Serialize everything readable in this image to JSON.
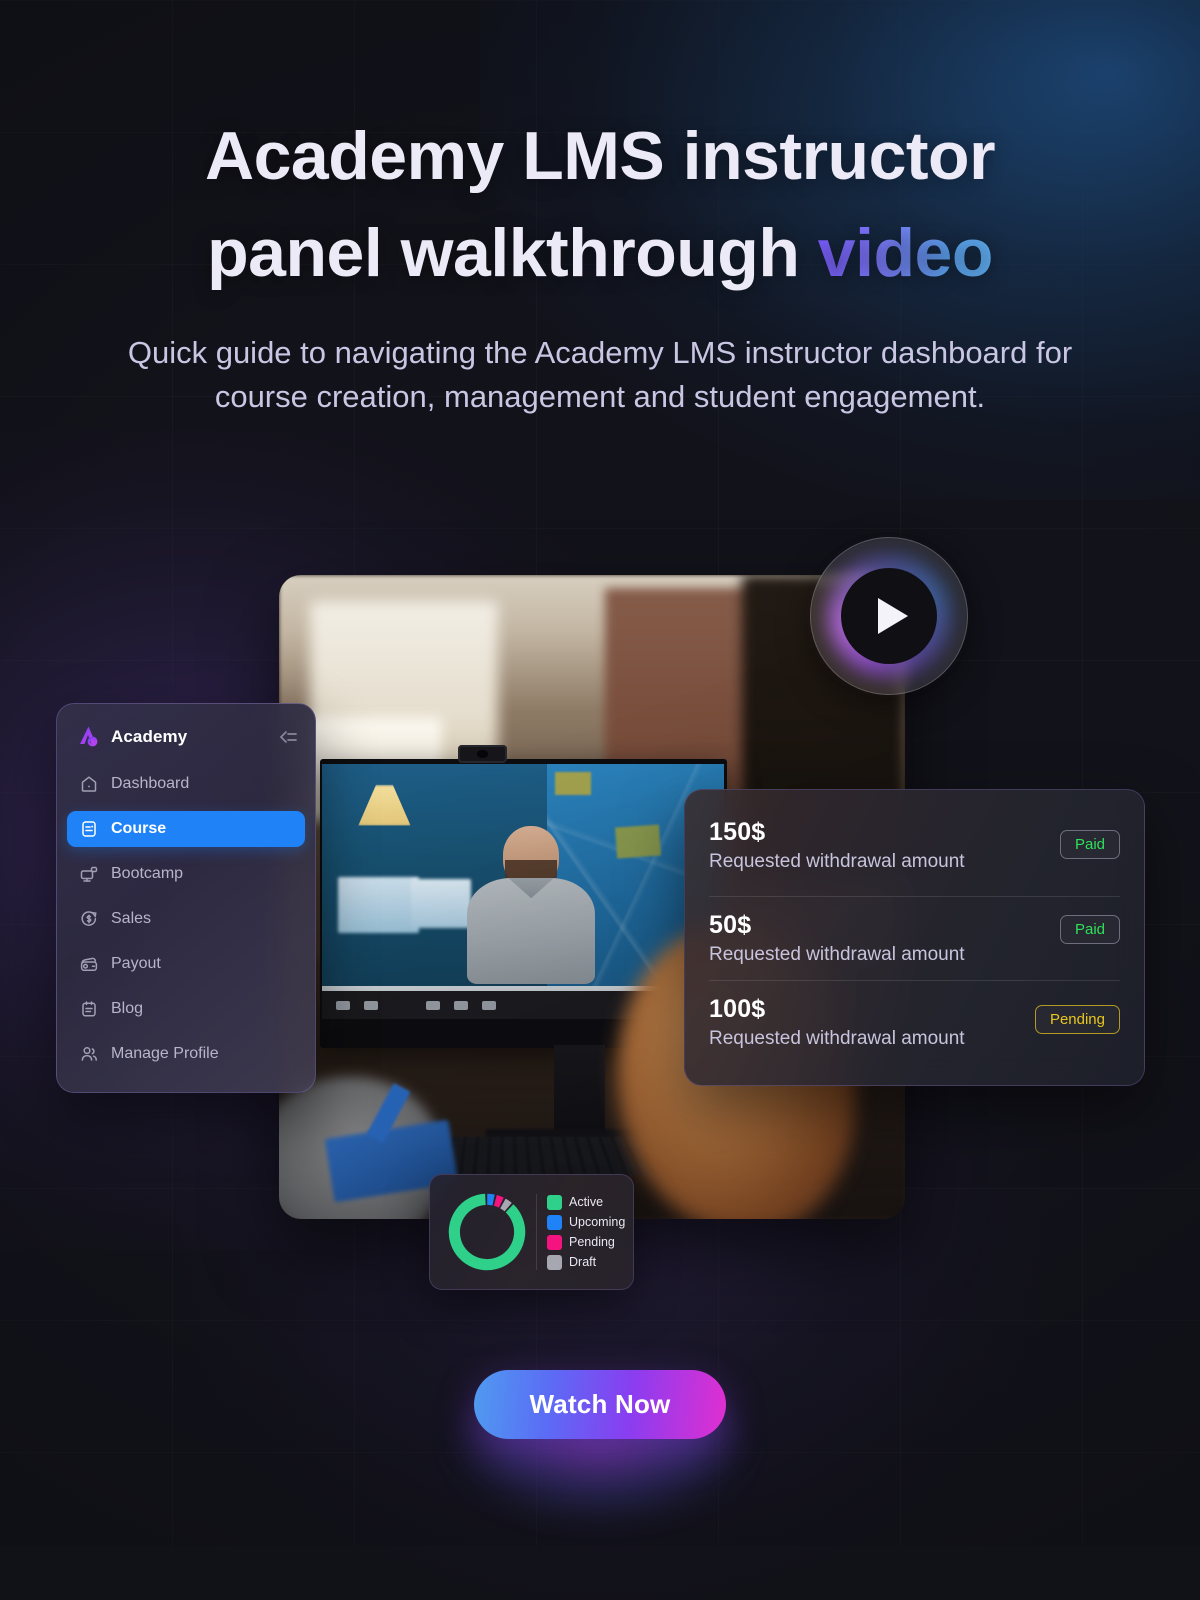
{
  "hero": {
    "title_line1": "Academy LMS instructor",
    "title_line2_prefix": "panel walkthrough ",
    "title_accent": "video",
    "subtitle": "Quick guide to navigating the Academy LMS instructor dashboard for course creation, management and student engagement."
  },
  "sidebar": {
    "brand": "Academy",
    "collapse_icon": "collapse-sidebar-icon",
    "logo_icon": "academy-logo-icon",
    "items": [
      {
        "label": "Dashboard",
        "icon": "home-icon",
        "active": false
      },
      {
        "label": "Course",
        "icon": "document-icon",
        "active": true
      },
      {
        "label": "Bootcamp",
        "icon": "monitor-icon",
        "active": false
      },
      {
        "label": "Sales",
        "icon": "dollar-circle-icon",
        "active": false
      },
      {
        "label": "Payout",
        "icon": "wallet-icon",
        "active": false
      },
      {
        "label": "Blog",
        "icon": "clipboard-icon",
        "active": false
      },
      {
        "label": "Manage Profile",
        "icon": "users-icon",
        "active": false
      }
    ]
  },
  "withdrawals": {
    "rows": [
      {
        "amount": "150$",
        "description": "Requested withdrawal amount",
        "status": "Paid",
        "status_type": "paid"
      },
      {
        "amount": "50$",
        "description": "Requested withdrawal amount",
        "status": "Paid",
        "status_type": "paid"
      },
      {
        "amount": "100$",
        "description": "Requested withdrawal amount",
        "status": "Pending",
        "status_type": "pending"
      }
    ]
  },
  "video": {
    "play_icon": "play-icon",
    "thumbnail_alt": "video-conference-thumbnail"
  },
  "cta": {
    "label": "Watch Now"
  },
  "chart_data": {
    "type": "pie",
    "title": "",
    "legend_position": "right",
    "categories": [
      "Active",
      "Upcoming",
      "Pending",
      "Draft"
    ],
    "values": [
      88,
      4,
      4,
      4
    ],
    "colors": [
      "#2fd18a",
      "#1f83f7",
      "#f5147f",
      "#a7a7b2"
    ]
  },
  "colors": {
    "accent_blue": "#1f83f7",
    "accent_purple": "#7b5cff",
    "paid_green": "#2fe05a",
    "pending_yellow": "#e8c620",
    "cta_gradient_start": "#4f9bf0",
    "cta_gradient_end": "#e02fd0",
    "background": "#12121a"
  }
}
